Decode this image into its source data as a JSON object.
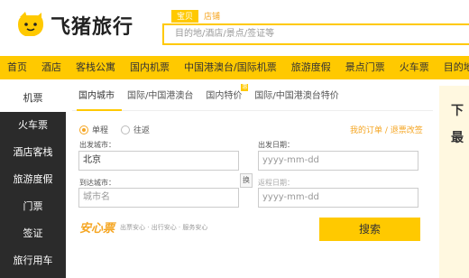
{
  "header": {
    "logo_text": "飞猪旅行",
    "search_tabs": [
      "宝贝",
      "店铺"
    ],
    "search_placeholder": "目的地/酒店/景点/签证等"
  },
  "nav": {
    "items": [
      "首页",
      "酒店",
      "客栈公寓",
      "国内机票",
      "中国港澳台/国际机票",
      "旅游度假",
      "景点门票",
      "火车票",
      "目的地"
    ]
  },
  "sidebar": {
    "top_item": "机票",
    "items": [
      "火车票",
      "酒店客栈",
      "旅游度假",
      "门票",
      "签证",
      "旅行用车"
    ]
  },
  "tabs": {
    "items": [
      "国内城市",
      "国际/中国港澳台",
      "国内特价",
      "国际/中国港澳台特价"
    ],
    "badge": "惠"
  },
  "form": {
    "radio_oneway": "单程",
    "radio_return": "往返",
    "order_link": "我的订单 / 退票改签",
    "from_label": "出发城市：",
    "from_value": "北京",
    "to_label": "到达城市：",
    "to_placeholder": "城市名",
    "depart_label": "出发日期：",
    "depart_placeholder": "yyyy-mm-dd",
    "return_label": "返程日期：",
    "return_placeholder": "yyyy-mm-dd",
    "swap_label": "换",
    "anxin_title": "安心票",
    "anxin_sub": "出票安心 · 出行安心 · 服务安心",
    "search_button": "搜索"
  },
  "right": {
    "chars": [
      "下",
      "最"
    ]
  },
  "colors": {
    "accent": "#ffc900",
    "accent_text": "#f5a623",
    "sidebar_bg": "#2b2b2b"
  }
}
